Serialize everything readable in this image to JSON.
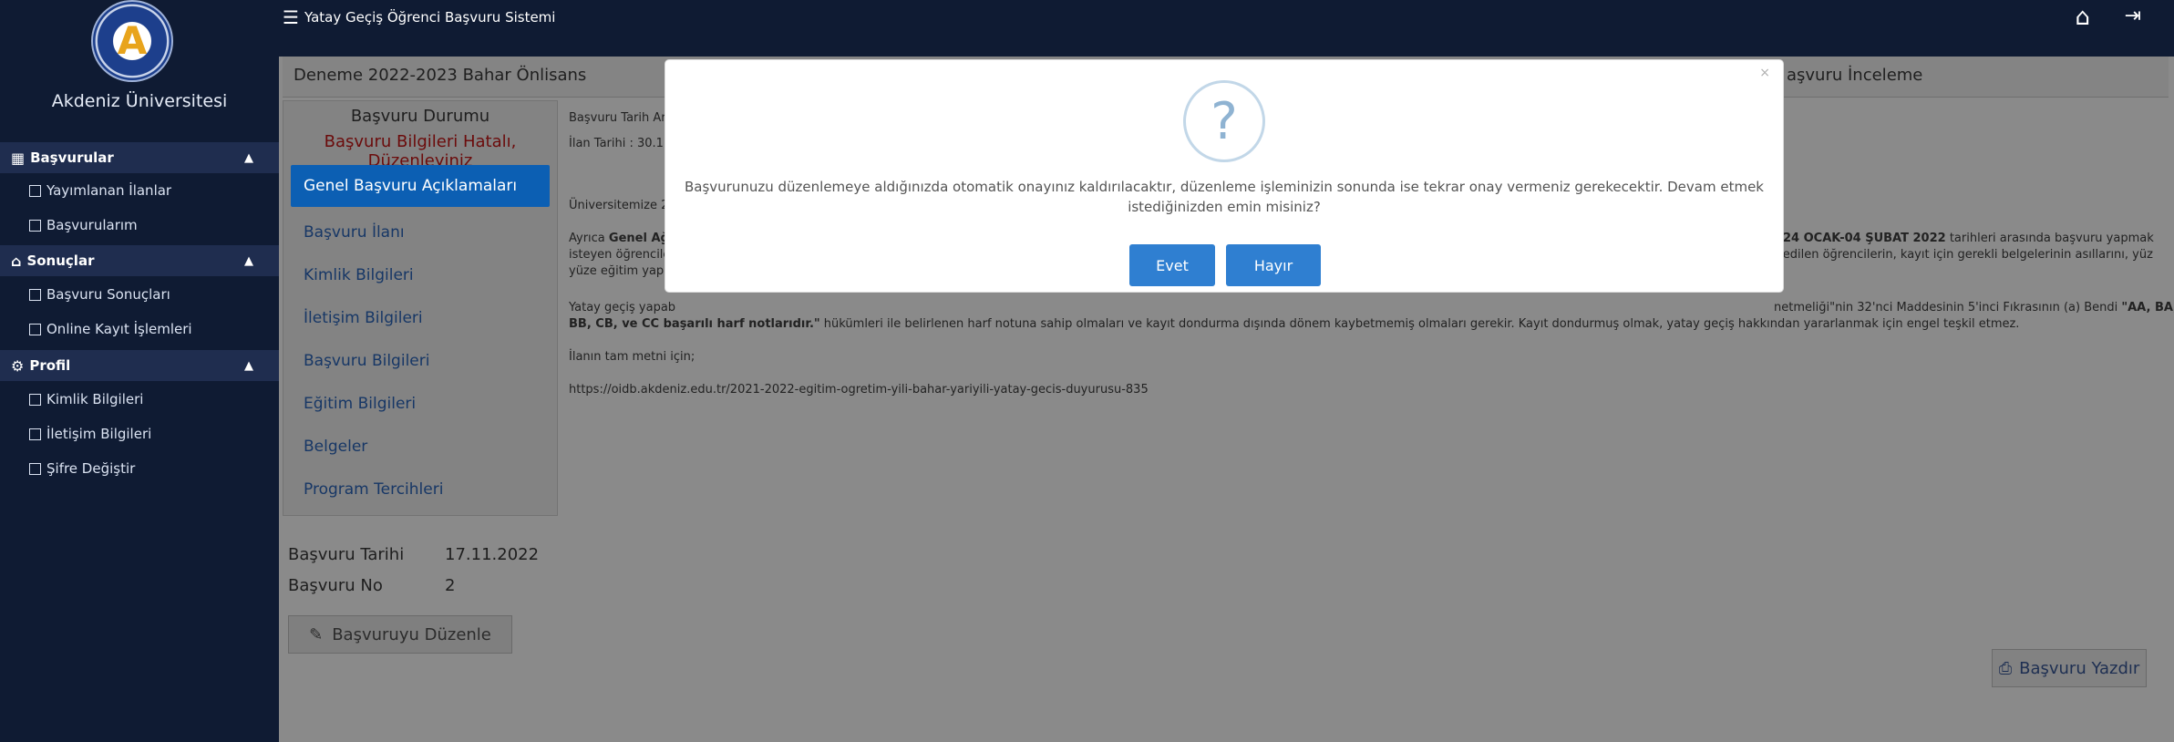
{
  "app": {
    "title": "Yatay Geçiş Öğrenci Başvuru Sistemi",
    "university": "Akdeniz Üniversitesi"
  },
  "sidebar": {
    "sections": [
      {
        "label": "Başvurular",
        "items": [
          "Yayımlanan İlanlar",
          "Başvurularım"
        ]
      },
      {
        "label": "Sonuçlar",
        "items": [
          "Başvuru Sonuçları",
          "Online Kayıt İşlemleri"
        ]
      },
      {
        "label": "Profil",
        "items": [
          "Kimlik Bilgileri",
          "İletişim Bilgileri",
          "Şifre Değiştir"
        ]
      }
    ]
  },
  "page": {
    "header": "Deneme 2022-2023 Bahar Önlisans",
    "right_header": "aşvuru İnceleme",
    "status_title": "Başvuru Durumu",
    "status_value": "Başvuru Bilgileri Hatalı, Düzenleyiniz",
    "tabs": [
      "Genel Başvuru Açıklamaları",
      "Başvuru İlanı",
      "Kimlik Bilgileri",
      "İletişim Bilgileri",
      "Başvuru Bilgileri",
      "Eğitim Bilgileri",
      "Belgeler",
      "Program Tercihleri"
    ],
    "date_label": "Başvuru Tarihi",
    "date_value": "17.11.2022",
    "no_label": "Başvuru No",
    "no_value": "2",
    "edit_button": "Başvuruyu Düzenle",
    "print_button": "Başvuru Yazdır"
  },
  "content": {
    "line1": "Başvuru Tarih Ara",
    "line2": "İlan Tarihi : 30.11",
    "line3": "Üniversitemize 20",
    "line4a": "Ayrıca ",
    "line4b": "Genel Ağı",
    "line4c": "24 OCAK-04 ŞUBAT 2022",
    "line4d": " tarihleri arasında başvuru yapmak",
    "line5a": "isteyen öğrencile",
    "line5b": "l edilen öğrencilerin, kayıt için gerekli belgelerinin asıllarını, yüz",
    "line6": "yüze eğitim yapıl",
    "line7a": "Yatay geçiş yapab",
    "line7b": "netmeliği\"nin 32'nci Maddesinin 5'inci Fıkrasının (a) Bendi ",
    "line7c": "\"AA, BA,",
    "line8a": "BB, CB, ve CC başarılı harf notlarıdır.\"",
    "line8b": " hükümleri ile belirlenen harf notuna sahip olmaları ve kayıt dondurma dışında dönem kaybetmemiş olmaları gerekir. Kayıt dondurmuş olmak, yatay geçiş hakkından yararlanmak için engel teşkil etmez.",
    "line9": "İlanın tam metni için;",
    "line10": "https://oidb.akdeniz.edu.tr/2021-2022-egitim-ogretim-yili-bahar-yariyili-yatay-gecis-duyurusu-835"
  },
  "modal": {
    "message": "Başvurunuzu düzenlemeye aldığınızda otomatik onayınız kaldırılacaktır, düzenleme işleminizin sonunda ise tekrar onay vermeniz gerekecektir. Devam etmek istediğinizden emin misiniz?",
    "confirm": "Evet",
    "cancel": "Hayır",
    "icon": "question-icon",
    "close": "×"
  },
  "colors": {
    "sidebar_bg": "#0f1b33",
    "primary": "#2f7fd1",
    "active_tab": "#0c5fb3",
    "status_error": "#6b0b0b"
  }
}
